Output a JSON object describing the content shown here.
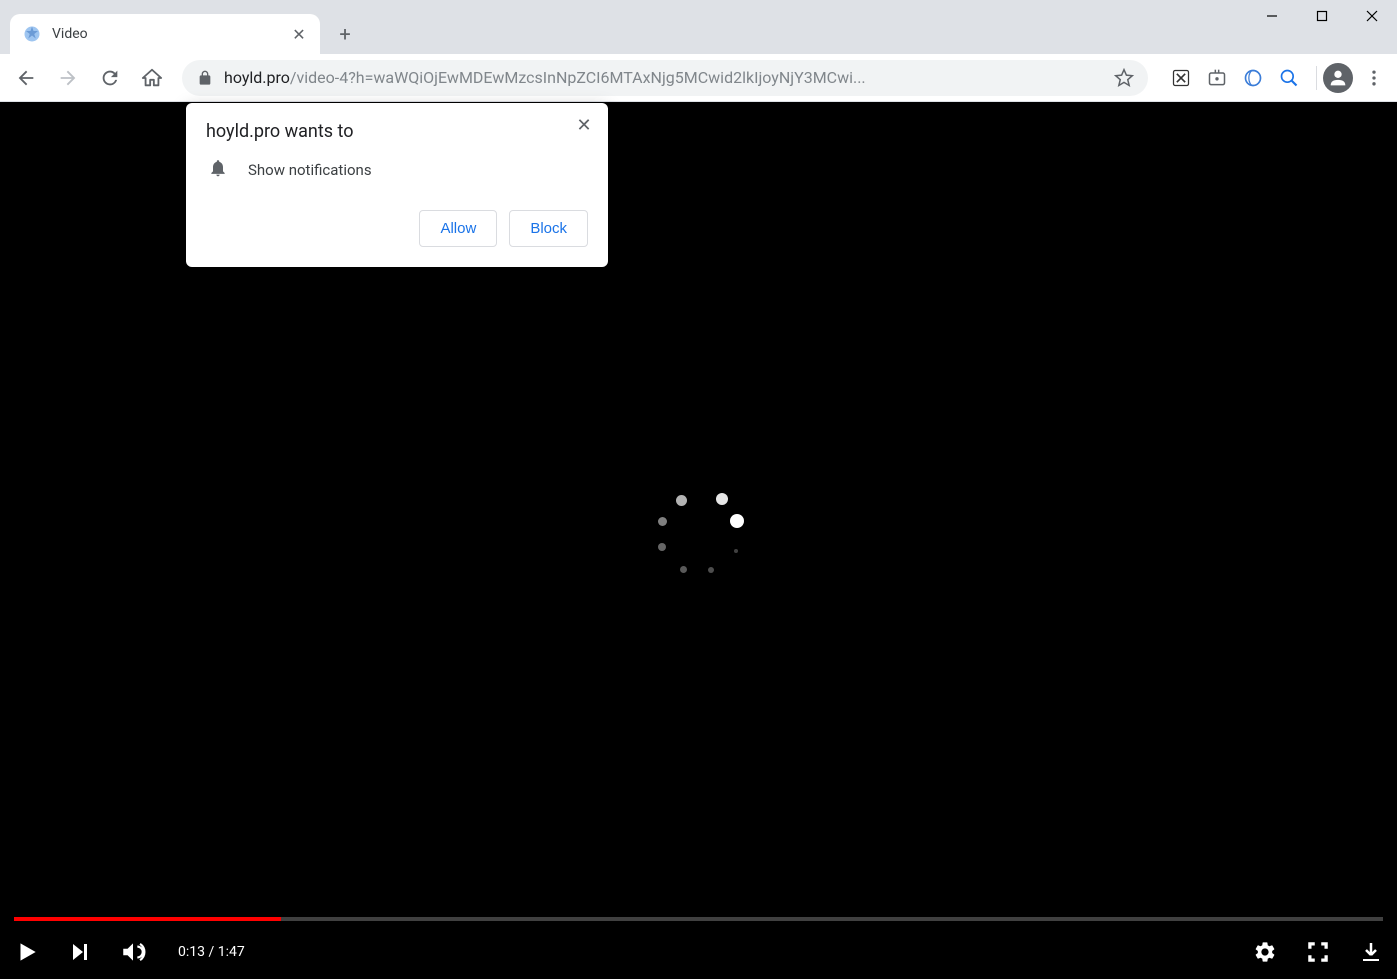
{
  "tab": {
    "title": "Video"
  },
  "url": {
    "host": "hoyld.pro",
    "path": "/video-4?h=waWQiOjEwMDEwMzcsInNpZCI6MTAxNjg5MCwid2lkIjoyNjY3MCwi..."
  },
  "notification": {
    "title": "hoyld.pro wants to",
    "body": "Show notifications",
    "allow_label": "Allow",
    "block_label": "Block"
  },
  "video": {
    "current_time": "0:13",
    "separator": " / ",
    "duration": "1:47"
  }
}
